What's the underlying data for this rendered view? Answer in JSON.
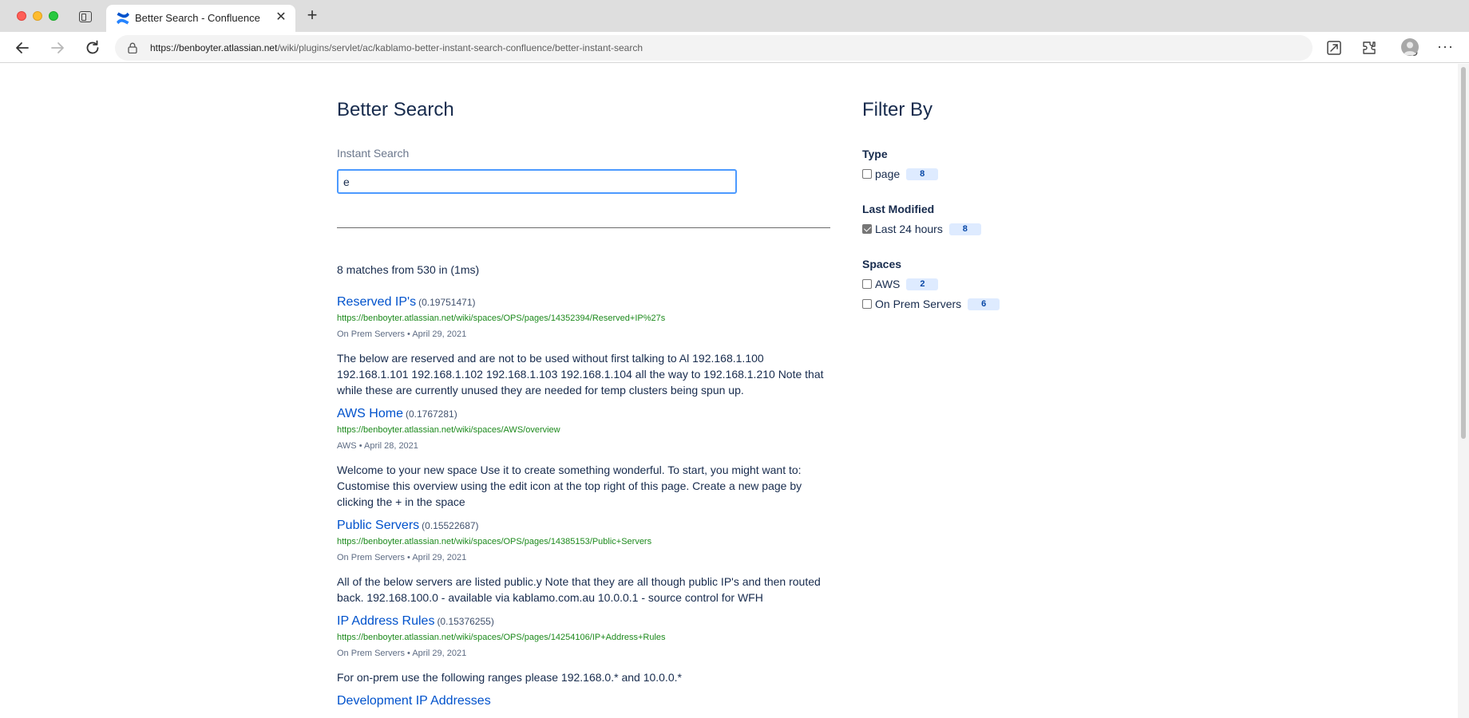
{
  "browser": {
    "tab_title": "Better Search - Confluence",
    "url_host": "https://benboyter.atlassian.net",
    "url_path": "/wiki/plugins/servlet/ac/kablamo-better-instant-search-confluence/better-instant-search"
  },
  "page": {
    "title": "Better Search",
    "search_label": "Instant Search",
    "search_value": "e",
    "match_summary": "8 matches from 530 in (1ms)",
    "meta_separator": "•",
    "results": [
      {
        "title": "Reserved IP's",
        "score": "(0.19751471)",
        "url": "https://benboyter.atlassian.net/wiki/spaces/OPS/pages/14352394/Reserved+IP%27s",
        "space": "On Prem Servers",
        "date": "April 29, 2021",
        "snippet": "The below are reserved and are not to be used without first talking to Al 192.168.1.100 192.168.1.101 192.168.1.102 192.168.1.103 192.168.1.104 all the way to 192.168.1.210 Note that while these are currently unused they are needed for temp clusters being spun up."
      },
      {
        "title": "AWS Home",
        "score": "(0.1767281)",
        "url": "https://benboyter.atlassian.net/wiki/spaces/AWS/overview",
        "space": "AWS",
        "date": "April 28, 2021",
        "snippet": "Welcome to your new space Use it to create something wonderful. To start, you might want to: Customise this overview  using the  edit icon  at the top right of this page. Create a new page  by clicking the  +  in the space"
      },
      {
        "title": "Public Servers",
        "score": "(0.15522687)",
        "url": "https://benboyter.atlassian.net/wiki/spaces/OPS/pages/14385153/Public+Servers",
        "space": "On Prem Servers",
        "date": "April 29, 2021",
        "snippet": "All of the below servers are listed public.y Note that they are all though public IP's and then routed back. 192.168.100.0 - available via kablamo.com.au 10.0.0.1 - source control for WFH"
      },
      {
        "title": "IP Address Rules",
        "score": "(0.15376255)",
        "url": "https://benboyter.atlassian.net/wiki/spaces/OPS/pages/14254106/IP+Address+Rules",
        "space": "On Prem Servers",
        "date": "April 29, 2021",
        "snippet": "For on-prem use the following ranges please 192.168.0.* and 10.0.0.*"
      }
    ],
    "cut_off_title": "Development IP Addresses"
  },
  "filters": {
    "title": "Filter By",
    "groups": [
      {
        "label": "Type",
        "items": [
          {
            "label": "page",
            "count": "8",
            "checked": false
          }
        ]
      },
      {
        "label": "Last Modified",
        "items": [
          {
            "label": "Last 24 hours",
            "count": "8",
            "checked": true
          }
        ]
      },
      {
        "label": "Spaces",
        "items": [
          {
            "label": "AWS",
            "count": "2",
            "checked": false
          },
          {
            "label": "On Prem Servers",
            "count": "6",
            "checked": false
          }
        ]
      }
    ]
  },
  "colors": {
    "link": "#0052cc",
    "url_green": "#1d8a1d",
    "focus_blue": "#4c9aff",
    "badge_bg": "#deebff"
  },
  "icons": [
    "tab-actions-icon",
    "confluence-logo-icon",
    "close-icon",
    "plus-icon",
    "back-arrow-icon",
    "forward-arrow-icon",
    "reload-icon",
    "lock-icon",
    "favorites-star-icon",
    "immersive-reader-icon",
    "extensions-icon",
    "profile-avatar-icon",
    "more-options-icon"
  ]
}
